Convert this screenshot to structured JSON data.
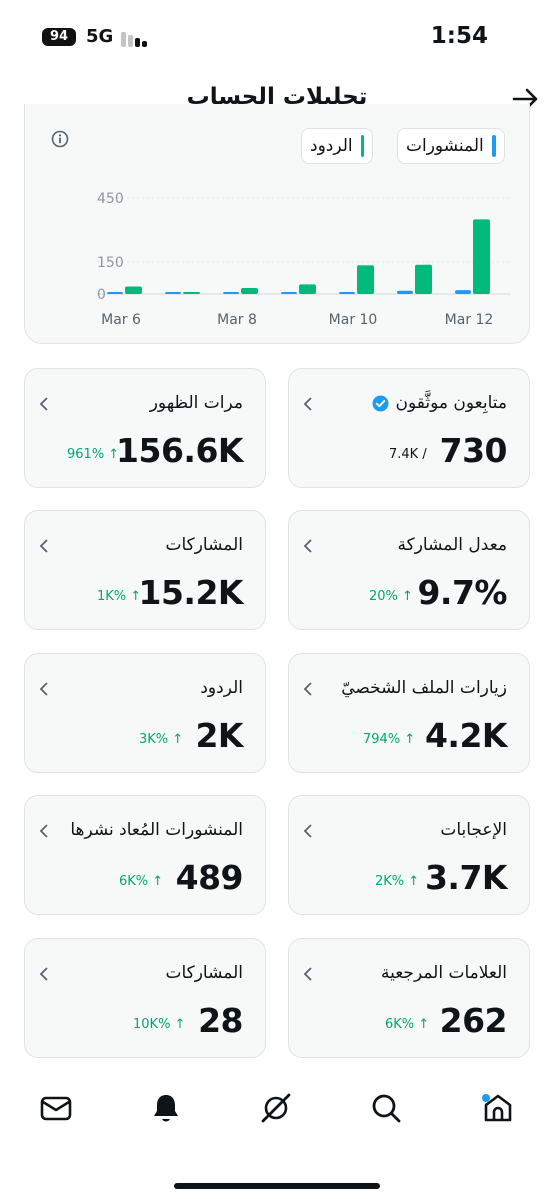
{
  "status_bar": {
    "battery": "94",
    "network": "5G",
    "time": "1:54"
  },
  "header": {
    "title": "تحليلات الحساب",
    "back_icon": "arrow-right-icon"
  },
  "legend": {
    "posts": "المنشورات",
    "replies": "الردود",
    "posts_color": "#1d9bf0",
    "replies_color": "#00ba7c"
  },
  "chart_data": {
    "type": "bar",
    "categories": [
      "Mar 6",
      "Mar 7",
      "Mar 8",
      "Mar 9",
      "Mar 10",
      "Mar 11",
      "Mar 12"
    ],
    "series": [
      {
        "name": "المنشورات",
        "values": [
          2,
          0,
          0,
          2,
          8,
          15,
          18
        ]
      },
      {
        "name": "الردود",
        "values": [
          35,
          8,
          28,
          45,
          135,
          137,
          350
        ]
      }
    ],
    "yticks": [
      "450",
      "150",
      "0"
    ],
    "xticks": [
      "Mar 6",
      "Mar 8",
      "Mar 10",
      "Mar 12"
    ],
    "ylim": [
      0,
      450
    ]
  },
  "stats": [
    {
      "label": "متابِعون موثَّقون",
      "value": "730",
      "sub": "7.4K /",
      "verified": true
    },
    {
      "label": "مرات الظهور",
      "value": "156.6K",
      "delta": "961% ↑"
    },
    {
      "label": "معدل المشاركة",
      "value": "9.7%",
      "delta": "20% ↑"
    },
    {
      "label": "المشاركات",
      "value": "15.2K",
      "delta": "1K% ↑"
    },
    {
      "label": "زيارات الملف الشخصيّ",
      "value": "4.2K",
      "delta": "794% ↑"
    },
    {
      "label": "الردود",
      "value": "2K",
      "delta": "3K% ↑"
    },
    {
      "label": "الإعجابات",
      "value": "3.7K",
      "delta": "2K% ↑"
    },
    {
      "label": "المنشورات المُعاد نشرها",
      "value": "489",
      "delta": "6K% ↑"
    },
    {
      "label": "العلامات المرجعية",
      "value": "262",
      "delta": "6K% ↑"
    },
    {
      "label": "المشاركات",
      "value": "28",
      "delta": "10K% ↑"
    }
  ],
  "nav": [
    "home-icon",
    "search-icon",
    "grok-icon",
    "bell-icon",
    "mail-icon"
  ]
}
